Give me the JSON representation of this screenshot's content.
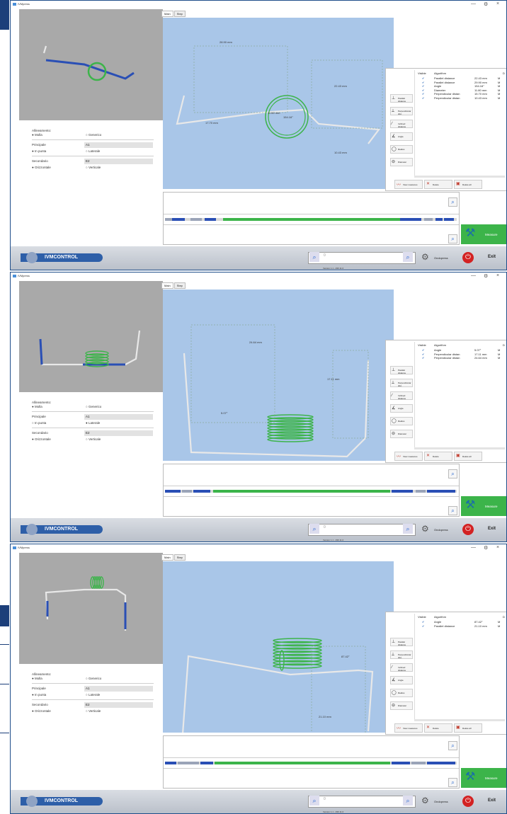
{
  "app": {
    "title": "IVMpress",
    "minimize": "—",
    "gear": "⚙",
    "close": "×"
  },
  "tabs": [
    "Main",
    "Step"
  ],
  "tools": [
    {
      "label": "Parallel distance",
      "icon": "parallel-distance-icon",
      "glyph": "⊥"
    },
    {
      "label": "Perpendicular dist.",
      "icon": "perpendicular-icon",
      "glyph": "⟂"
    },
    {
      "label": "Inclined distance",
      "icon": "inclined-icon",
      "glyph": "∕"
    },
    {
      "label": "Angle",
      "icon": "angle-icon",
      "glyph": "∡"
    },
    {
      "label": "Radius",
      "icon": "radius-icon",
      "glyph": "◯"
    },
    {
      "label": "Diameter",
      "icon": "diameter-icon",
      "glyph": "⊖"
    }
  ],
  "result_headers": {
    "visible": "Visible",
    "algorithm": "Algorithm",
    "extra": "D"
  },
  "bottom_buttons": [
    {
      "label": "View measures",
      "icon": "view-icon",
      "glyph": "〰"
    },
    {
      "label": "Delete",
      "icon": "delete-icon",
      "glyph": "✕"
    },
    {
      "label": "Delete all",
      "icon": "delete-all-icon",
      "glyph": "▣"
    }
  ],
  "param_labels": {
    "mode": "Allineamento:",
    "mode_a": "Molla",
    "mode_b": "Generico",
    "primary": "Principale",
    "primary_val": "A1",
    "primary_a": "In punta",
    "primary_b": "Laterale",
    "secondary": "Secondario",
    "secondary_val": "E2",
    "secondary_a": "Orizzontale",
    "secondary_b": "Verticale"
  },
  "footer": {
    "logo": "IVMCONTROL",
    "search_value": "0",
    "controller": "Ondopress",
    "exit": "Exit",
    "version": "Version 1.1 - 296 11.0",
    "measure": "Measure"
  },
  "panels": [
    {
      "results": [
        {
          "name": "Parallel distance",
          "value": "22.43 mm",
          "unit": "M"
        },
        {
          "name": "Parallel distance",
          "value": "29.90 mm",
          "unit": "M"
        },
        {
          "name": "Angle",
          "value": "154.16°",
          "unit": "M"
        },
        {
          "name": "Diameter",
          "value": "11.80 mm",
          "unit": "M"
        },
        {
          "name": "Perpendicular distan",
          "value": "15.70 mm",
          "unit": "M"
        },
        {
          "name": "Perpendicular distan",
          "value": "10.43 mm",
          "unit": "M"
        }
      ],
      "primary_selected": "In punta",
      "annotations": [
        "28.90 mm",
        "22.43 mm",
        "17.70 mm",
        "11.80 mm",
        "154.16°",
        "10.43 mm"
      ]
    },
    {
      "results": [
        {
          "name": "Angle",
          "value": "5.07°",
          "unit": "M"
        },
        {
          "name": "Perpendicular distan",
          "value": "17.11 mm",
          "unit": "M"
        },
        {
          "name": "Perpendicular distan",
          "value": "24.64 mm",
          "unit": "M"
        }
      ],
      "primary_selected": "Laterale",
      "annotations": [
        "24.64 mm",
        "17.11 mm",
        "5.07°"
      ]
    },
    {
      "results": [
        {
          "name": "Angle",
          "value": "87.42°",
          "unit": "M"
        },
        {
          "name": "Parallel distance",
          "value": "21.10 mm",
          "unit": "M"
        }
      ],
      "primary_selected": "In punta",
      "annotations": [
        "87.42°",
        "21.10 mm"
      ]
    }
  ],
  "colors": {
    "navy": "#1c3f7a",
    "canvas": "#a9c6e8",
    "spring": "#3cb44a",
    "wire_blue": "#2a4fb5",
    "measure_green": "#3cb44a"
  }
}
